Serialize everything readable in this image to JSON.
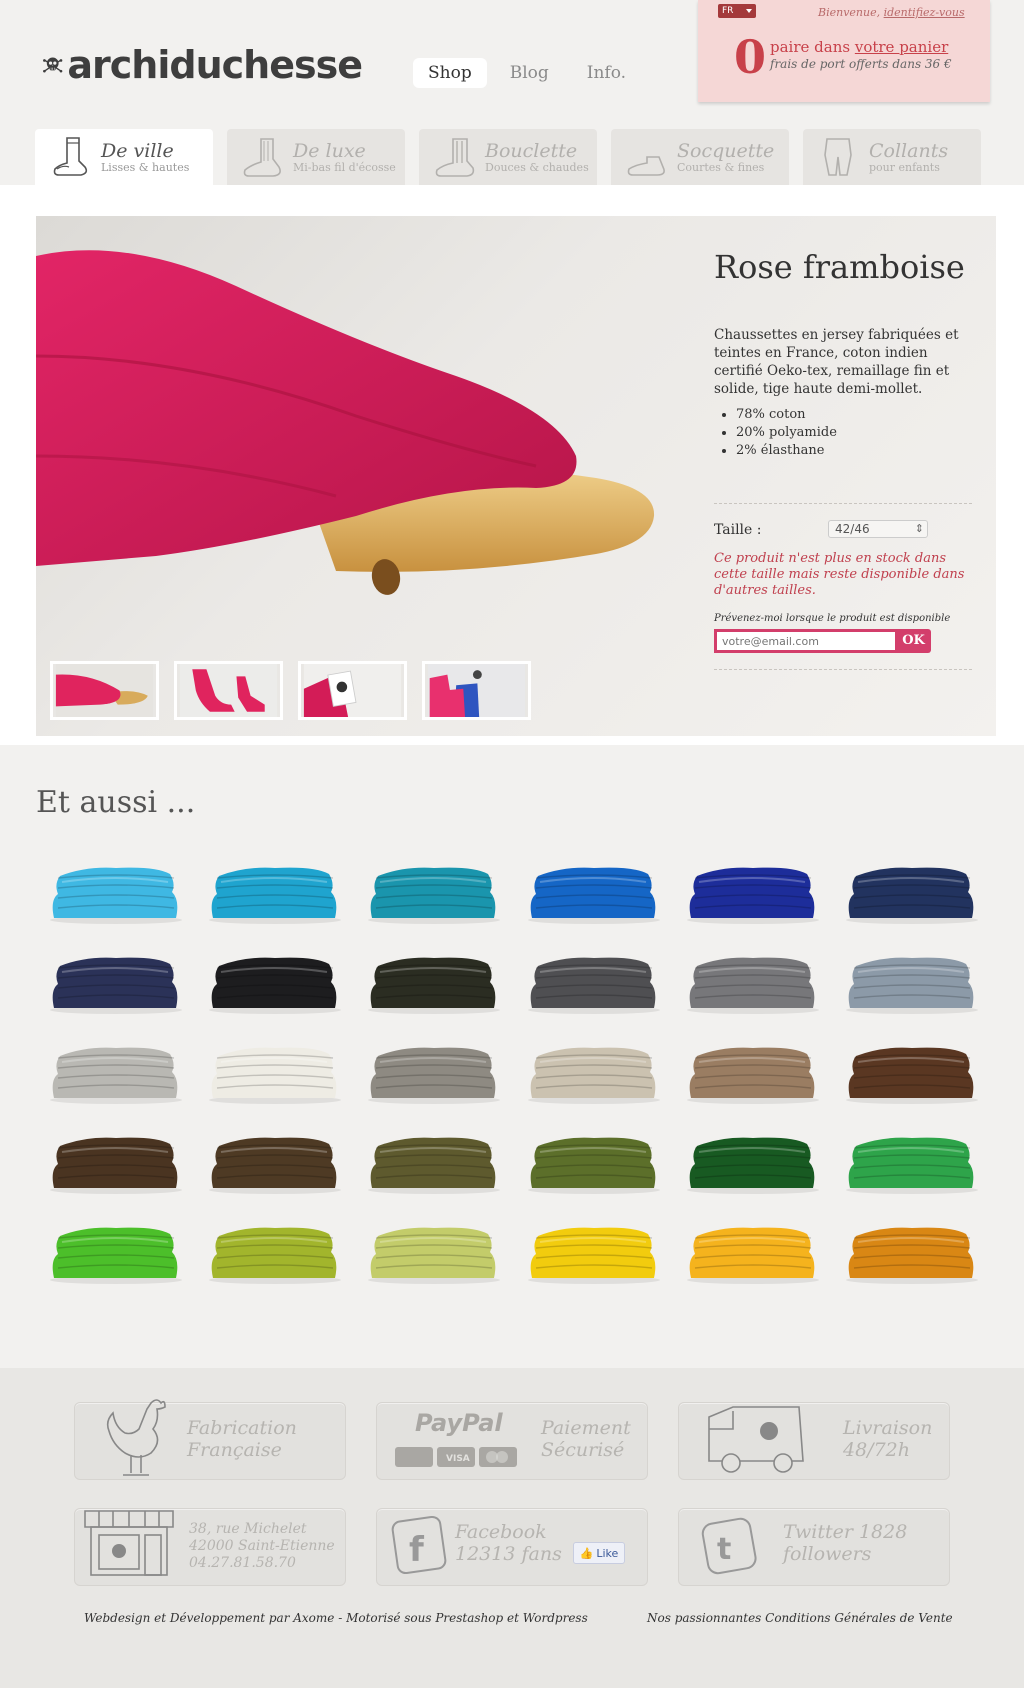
{
  "header": {
    "logo_text": "archiduchesse",
    "nav": [
      {
        "label": "Shop"
      },
      {
        "label": "Blog"
      },
      {
        "label": "Info."
      }
    ],
    "lang": "FR",
    "welcome_text": "Bienvenue,",
    "login_link": "identifiez-vous",
    "cart_count": "0",
    "cart_text": "paire dans",
    "cart_link": "votre panier",
    "shipping_text": "frais de port offerts dans 36 €",
    "cart_bg_color": "#f5d7d6"
  },
  "categories": [
    {
      "title": "De ville",
      "subtitle": "Lisses & hautes",
      "icon": "sock-high-icon"
    },
    {
      "title": "De luxe",
      "subtitle": "Mi-bas fil d'écosse",
      "icon": "sock-luxe-icon"
    },
    {
      "title": "Bouclette",
      "subtitle": "Douces & chaudes",
      "icon": "sock-bouclette-icon"
    },
    {
      "title": "Socquette",
      "subtitle": "Courtes & fines",
      "icon": "sock-short-icon"
    },
    {
      "title": "Collants",
      "subtitle": "pour enfants",
      "icon": "tights-icon"
    }
  ],
  "product": {
    "title": "Rose framboise",
    "description": "Chaussettes en jersey fabriquées et teintes en France, coton indien certifié Oeko-tex,  remaillage  fin et solide, tige haute demi-mollet.",
    "specs": [
      "78% coton",
      "20% polyamide",
      "2% élasthane"
    ],
    "size_label": "Taille :",
    "size_value": "42/46",
    "stock_message": "Ce produit n'est plus en stock dans cette taille mais reste disponible dans d'autres tailles.",
    "notify_label": "Prévenez-moi lorsque le produit est disponible",
    "email_placeholder": "votre@email.com",
    "ok_label": "OK",
    "main_color": "#e0245e"
  },
  "also": {
    "title": "Et aussi ...",
    "colors": [
      "#3fb8e3",
      "#1fa4cf",
      "#1a95ad",
      "#1566c6",
      "#1d2d9a",
      "#22335f",
      "#2b3258",
      "#1d1d1f",
      "#2b2d22",
      "#4f4f52",
      "#77777a",
      "#8c9aa8",
      "#b9b8b3",
      "#eeece4",
      "#8e8a82",
      "#cbc2b0",
      "#9a7d62",
      "#5a3722",
      "#4a3421",
      "#4e3a24",
      "#5e5a2e",
      "#5c6f2a",
      "#185a22",
      "#2ea44a",
      "#4cbf2a",
      "#a2b52c",
      "#c3cc6a",
      "#f2cc0e",
      "#f5b31d",
      "#d98714"
    ]
  },
  "footer": {
    "badges": [
      {
        "line1": "Fabrication",
        "line2": "Française",
        "icon": "rooster-icon"
      },
      {
        "line1": "Paiement",
        "line2": "Sécurisé",
        "icon": "paypal-icon",
        "logo": "PayPal",
        "card_visa": "VISA"
      },
      {
        "line1": "Livraison",
        "line2": "48/72h",
        "icon": "delivery-truck-icon"
      },
      {
        "line1": "38, rue Michelet",
        "line2": "42000 Saint-Etienne",
        "line3": "04.27.81.58.70",
        "icon": "shop-icon"
      },
      {
        "line1": "Facebook",
        "line2": "12313 fans",
        "icon": "facebook-icon",
        "like": "Like"
      },
      {
        "line1": "Twitter 1828",
        "line2": "followers",
        "icon": "twitter-icon"
      }
    ],
    "credit": "Webdesign et Développement par Axome - Motorisé sous Prestashop et Wordpress",
    "cgv": "Nos passionnantes Conditions Générales de Vente"
  }
}
